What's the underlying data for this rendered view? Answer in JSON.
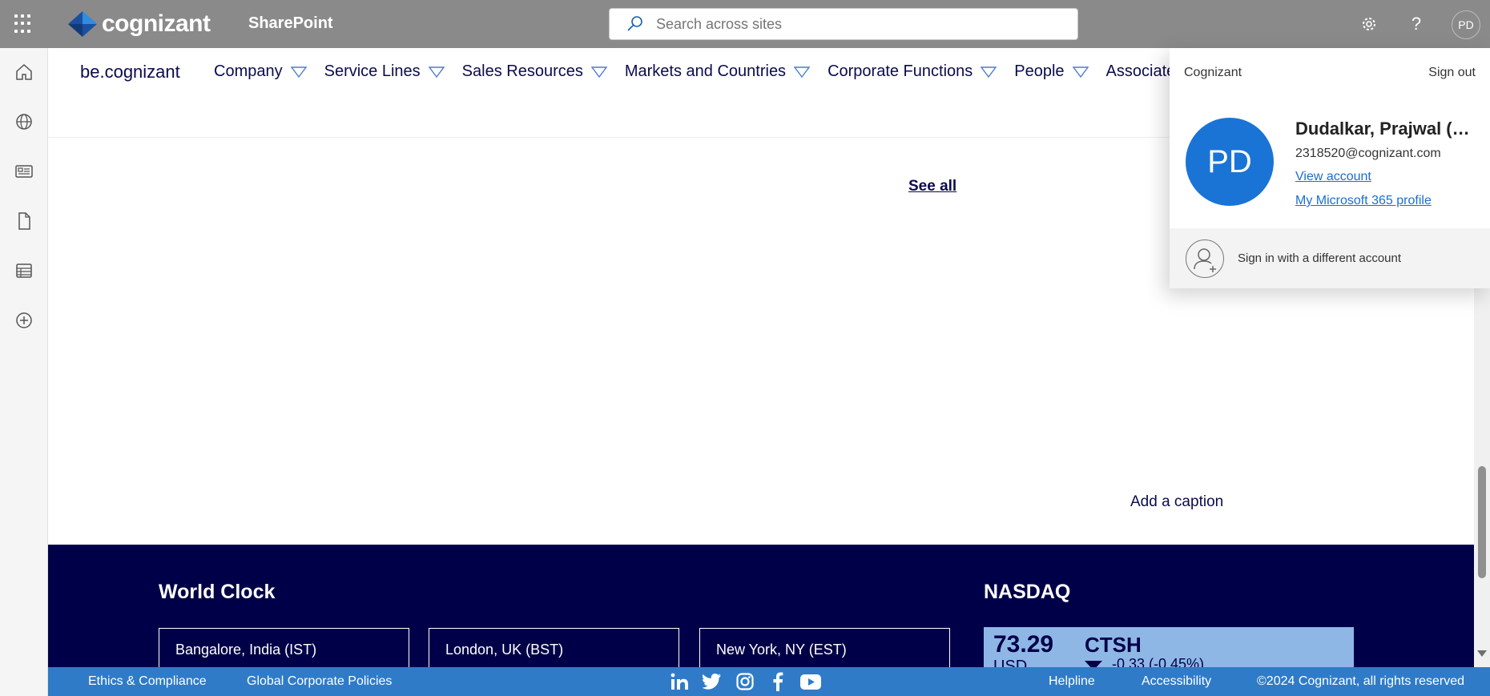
{
  "suitebar": {
    "logo_text": "cognizant",
    "app_name": "SharePoint",
    "search_placeholder": "Search across sites",
    "avatar_initials": "PD",
    "help_glyph": "?",
    "icons": [
      "app-launcher-icon",
      "settings-gear-icon",
      "help-icon"
    ]
  },
  "leftrail": {
    "icons": [
      "home-icon",
      "globe-icon",
      "news-icon",
      "file-icon",
      "list-icon",
      "add-circle-icon"
    ]
  },
  "sitenav": {
    "site_title": "be.cognizant",
    "items": [
      {
        "label": "Company"
      },
      {
        "label": "Service Lines"
      },
      {
        "label": "Sales Resources"
      },
      {
        "label": "Markets and Countries"
      },
      {
        "label": "Corporate Functions"
      },
      {
        "label": "People"
      },
      {
        "label": "Associate Di"
      }
    ]
  },
  "main": {
    "see_all": "See all",
    "caption": "Add a caption"
  },
  "footer": {
    "world_clock_title": "World Clock",
    "clocks": [
      {
        "label": "Bangalore, India (IST)"
      },
      {
        "label": "London, UK (BST)"
      },
      {
        "label": "New York, NY (EST)"
      }
    ],
    "nasdaq": {
      "title": "NASDAQ",
      "price": "73.29",
      "currency": "USD",
      "symbol": "CTSH",
      "change": "-0.33  (-0.45%)"
    },
    "links": {
      "ethics": "Ethics & Compliance",
      "policies": "Global Corporate Policies",
      "helpline": "Helpline",
      "accessibility": "Accessibility",
      "copyright": "©2024 Cognizant, all rights reserved"
    },
    "social_icons": [
      "linkedin-icon",
      "twitter-icon",
      "instagram-icon",
      "facebook-icon",
      "youtube-icon"
    ]
  },
  "account_flyout": {
    "org": "Cognizant",
    "sign_out": "Sign out",
    "initials": "PD",
    "name": "Dudalkar, Prajwal (…",
    "email": "2318520@cognizant.com",
    "view_account": "View account",
    "m365_profile": "My Microsoft 365 profile",
    "switch_account": "Sign in with a different account"
  },
  "colors": {
    "suitebar": "#8a8a8a",
    "nav_text": "#0b0b4e",
    "footer_dark": "#000048",
    "footer_bar": "#2f7bc8",
    "nasdaq_box": "#8fb7e6",
    "avatar_blue": "#1a74d6",
    "link_blue": "#1a6fcf"
  }
}
